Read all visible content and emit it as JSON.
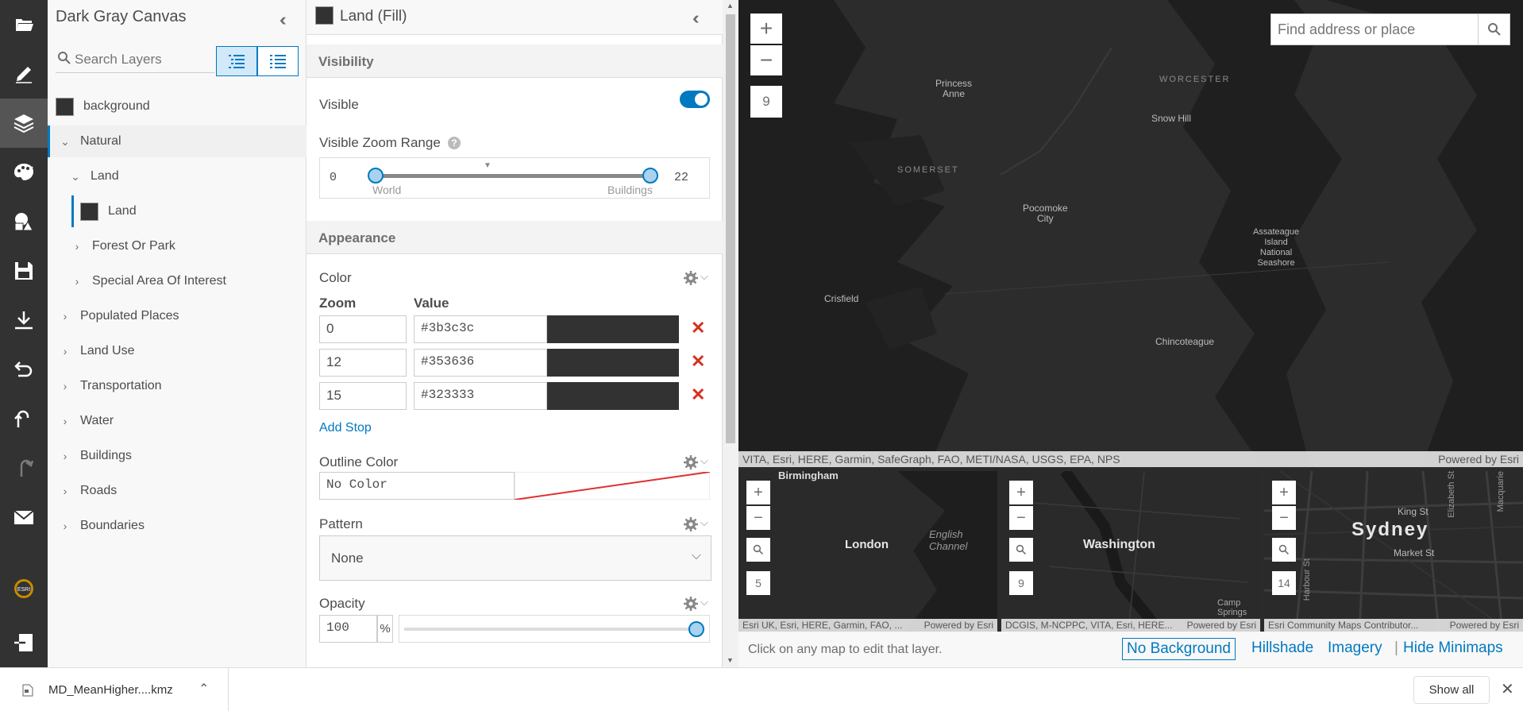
{
  "toolbar": {
    "tools": [
      {
        "icon": "folder-open-icon",
        "label": "open"
      },
      {
        "icon": "pencil-icon",
        "label": "edit"
      },
      {
        "icon": "layers-icon",
        "label": "layers"
      },
      {
        "icon": "palette-icon",
        "label": "palette"
      },
      {
        "icon": "shapes-icon",
        "label": "shapes"
      },
      {
        "icon": "save-icon",
        "label": "save"
      },
      {
        "icon": "download-icon",
        "label": "download"
      },
      {
        "icon": "undo-history-icon",
        "label": "revert"
      },
      {
        "icon": "undo-icon",
        "label": "undo"
      },
      {
        "icon": "redo-icon",
        "label": "redo"
      },
      {
        "icon": "mail-icon",
        "label": "mail"
      },
      {
        "icon": "esri-logo-icon",
        "label": "esri"
      },
      {
        "icon": "exit-icon",
        "label": "exit"
      }
    ],
    "esri_logo_text": "ESRI"
  },
  "layers_panel": {
    "title": "Dark Gray Canvas",
    "search_placeholder": "Search Layers",
    "items": [
      {
        "label": "background",
        "level": 0,
        "swatch": "#323232"
      },
      {
        "label": "Natural",
        "level": 0,
        "expanded": true
      },
      {
        "label": "Land",
        "level": 1,
        "expanded": true
      },
      {
        "label": "Land",
        "level": 2,
        "swatch": "#323232",
        "selected": true
      },
      {
        "label": "Forest Or Park",
        "level": 1
      },
      {
        "label": "Special Area Of Interest",
        "level": 1
      },
      {
        "label": "Populated Places",
        "level": 0
      },
      {
        "label": "Land Use",
        "level": 0
      },
      {
        "label": "Transportation",
        "level": 0
      },
      {
        "label": "Water",
        "level": 0
      },
      {
        "label": "Buildings",
        "level": 0
      },
      {
        "label": "Roads",
        "level": 0
      },
      {
        "label": "Boundaries",
        "level": 0
      }
    ]
  },
  "editor": {
    "title": "Land (Fill)",
    "visibility_header": "Visibility",
    "visible_label": "Visible",
    "visible": true,
    "zoom_range_label": "Visible Zoom Range",
    "zoom_min": "0",
    "zoom_max": "22",
    "zoom_min_caption": "World",
    "zoom_max_caption": "Buildings",
    "appearance_header": "Appearance",
    "color_label": "Color",
    "zoom_col": "Zoom",
    "value_col": "Value",
    "stops": [
      {
        "zoom": "0",
        "value": "#3b3c3c"
      },
      {
        "zoom": "12",
        "value": "#353636"
      },
      {
        "zoom": "15",
        "value": "#323333"
      }
    ],
    "add_stop": "Add Stop",
    "outline_label": "Outline Color",
    "outline_value": "No Color",
    "pattern_label": "Pattern",
    "pattern_value": "None",
    "opacity_label": "Opacity",
    "opacity_value": "100",
    "opacity_unit": "%",
    "opacity_level": 1.0
  },
  "map": {
    "search_placeholder": "Find address or place",
    "zoom_level": "9",
    "places": [
      {
        "name": "Princess\nAnne",
        "type": "town"
      },
      {
        "name": "WORCESTER",
        "type": "region"
      },
      {
        "name": "Snow Hill",
        "type": "town"
      },
      {
        "name": "SOMERSET",
        "type": "region"
      },
      {
        "name": "Pocomoke\nCity",
        "type": "town"
      },
      {
        "name": "Assateague\nIsland\nNational\nSeashore",
        "type": "town"
      },
      {
        "name": "Crisfield",
        "type": "town"
      },
      {
        "name": "Chincoteague",
        "type": "town"
      }
    ],
    "attribution": "VITA, Esri, HERE, Garmin, SafeGraph, FAO, METI/NASA, USGS, EPA, NPS",
    "powered_by": "Powered by Esri",
    "minimaps": [
      {
        "city": "London",
        "zoom": "5",
        "extra_labels": [
          "Birmingham",
          "English\nChannel"
        ],
        "attribution": "Esri UK, Esri, HERE, Garmin, FAO, ...",
        "powered_by": "Powered by Esri"
      },
      {
        "city": "Washington",
        "zoom": "9",
        "extra_labels": [
          "Camp\nSprings"
        ],
        "attribution": "DCGIS, M-NCPPC, VITA, Esri, HERE...",
        "powered_by": "Powered by Esri"
      },
      {
        "city": "Sydney",
        "zoom": "14",
        "extra_labels": [
          "King St",
          "Market St",
          "Elizabeth St",
          "Macquarie",
          "Harbour St"
        ],
        "attribution": "Esri Community Maps Contributor...",
        "powered_by": "Powered by Esri"
      }
    ],
    "footer_hint": "Click on any map to edit that layer.",
    "bg_options": [
      "No Background",
      "Hillshade",
      "Imagery",
      "Hide Minimaps"
    ],
    "bg_separator": "|"
  },
  "downloads": {
    "file_name": "MD_MeanHigher....kmz",
    "show_all": "Show all"
  },
  "colors": {
    "accent": "#0079c1",
    "toolbar": "#323232",
    "delete": "#d83020",
    "stop_swatch": "#323232"
  }
}
